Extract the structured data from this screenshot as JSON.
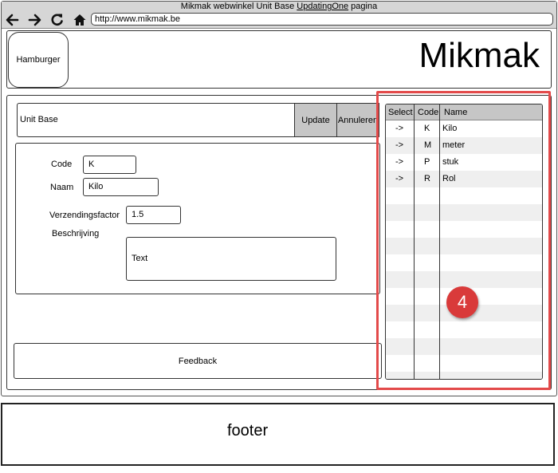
{
  "browser": {
    "title_prefix": "Mikmak webwinkel Unit Base ",
    "title_link": "UpdatingOne",
    "title_suffix": " pagina",
    "url": "http://www.mikmak.be",
    "icons": [
      "back-arrow-icon",
      "forward-arrow-icon",
      "reload-icon",
      "home-icon"
    ]
  },
  "header": {
    "hamburger_label": "Hamburger",
    "brand": "Mikmak"
  },
  "unit_bar": {
    "title": "Unit Base",
    "update_label": "Update",
    "cancel_label": "Annuleren"
  },
  "form": {
    "code_label": "Code",
    "code_value": "K",
    "name_label": "Naam",
    "name_value": "Kilo",
    "shipping_label": "Verzendingsfactor",
    "shipping_value": "1.5",
    "description_label": "Beschrijving",
    "description_value": "Text"
  },
  "feedback_label": "Feedback",
  "table": {
    "headers": [
      "Select",
      "Code",
      "Name"
    ],
    "rows": [
      {
        "select": "->",
        "code": "K",
        "name": "Kilo"
      },
      {
        "select": "->",
        "code": "M",
        "name": "meter"
      },
      {
        "select": "->",
        "code": "P",
        "name": "stuk"
      },
      {
        "select": "->",
        "code": "R",
        "name": "Rol"
      }
    ]
  },
  "annotation": {
    "number": "4",
    "color": "#e34a4a"
  },
  "footer": {
    "text": "footer"
  }
}
